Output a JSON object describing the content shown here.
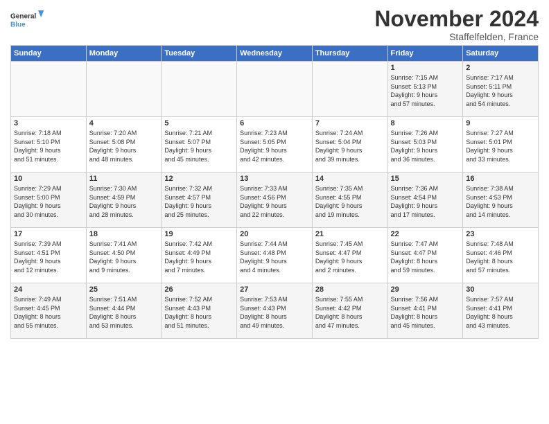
{
  "logo": {
    "line1": "General",
    "line2": "Blue"
  },
  "title": "November 2024",
  "location": "Staffelfelden, France",
  "days_of_week": [
    "Sunday",
    "Monday",
    "Tuesday",
    "Wednesday",
    "Thursday",
    "Friday",
    "Saturday"
  ],
  "weeks": [
    [
      {
        "day": "",
        "info": ""
      },
      {
        "day": "",
        "info": ""
      },
      {
        "day": "",
        "info": ""
      },
      {
        "day": "",
        "info": ""
      },
      {
        "day": "",
        "info": ""
      },
      {
        "day": "1",
        "info": "Sunrise: 7:15 AM\nSunset: 5:13 PM\nDaylight: 9 hours\nand 57 minutes."
      },
      {
        "day": "2",
        "info": "Sunrise: 7:17 AM\nSunset: 5:11 PM\nDaylight: 9 hours\nand 54 minutes."
      }
    ],
    [
      {
        "day": "3",
        "info": "Sunrise: 7:18 AM\nSunset: 5:10 PM\nDaylight: 9 hours\nand 51 minutes."
      },
      {
        "day": "4",
        "info": "Sunrise: 7:20 AM\nSunset: 5:08 PM\nDaylight: 9 hours\nand 48 minutes."
      },
      {
        "day": "5",
        "info": "Sunrise: 7:21 AM\nSunset: 5:07 PM\nDaylight: 9 hours\nand 45 minutes."
      },
      {
        "day": "6",
        "info": "Sunrise: 7:23 AM\nSunset: 5:05 PM\nDaylight: 9 hours\nand 42 minutes."
      },
      {
        "day": "7",
        "info": "Sunrise: 7:24 AM\nSunset: 5:04 PM\nDaylight: 9 hours\nand 39 minutes."
      },
      {
        "day": "8",
        "info": "Sunrise: 7:26 AM\nSunset: 5:03 PM\nDaylight: 9 hours\nand 36 minutes."
      },
      {
        "day": "9",
        "info": "Sunrise: 7:27 AM\nSunset: 5:01 PM\nDaylight: 9 hours\nand 33 minutes."
      }
    ],
    [
      {
        "day": "10",
        "info": "Sunrise: 7:29 AM\nSunset: 5:00 PM\nDaylight: 9 hours\nand 30 minutes."
      },
      {
        "day": "11",
        "info": "Sunrise: 7:30 AM\nSunset: 4:59 PM\nDaylight: 9 hours\nand 28 minutes."
      },
      {
        "day": "12",
        "info": "Sunrise: 7:32 AM\nSunset: 4:57 PM\nDaylight: 9 hours\nand 25 minutes."
      },
      {
        "day": "13",
        "info": "Sunrise: 7:33 AM\nSunset: 4:56 PM\nDaylight: 9 hours\nand 22 minutes."
      },
      {
        "day": "14",
        "info": "Sunrise: 7:35 AM\nSunset: 4:55 PM\nDaylight: 9 hours\nand 19 minutes."
      },
      {
        "day": "15",
        "info": "Sunrise: 7:36 AM\nSunset: 4:54 PM\nDaylight: 9 hours\nand 17 minutes."
      },
      {
        "day": "16",
        "info": "Sunrise: 7:38 AM\nSunset: 4:53 PM\nDaylight: 9 hours\nand 14 minutes."
      }
    ],
    [
      {
        "day": "17",
        "info": "Sunrise: 7:39 AM\nSunset: 4:51 PM\nDaylight: 9 hours\nand 12 minutes."
      },
      {
        "day": "18",
        "info": "Sunrise: 7:41 AM\nSunset: 4:50 PM\nDaylight: 9 hours\nand 9 minutes."
      },
      {
        "day": "19",
        "info": "Sunrise: 7:42 AM\nSunset: 4:49 PM\nDaylight: 9 hours\nand 7 minutes."
      },
      {
        "day": "20",
        "info": "Sunrise: 7:44 AM\nSunset: 4:48 PM\nDaylight: 9 hours\nand 4 minutes."
      },
      {
        "day": "21",
        "info": "Sunrise: 7:45 AM\nSunset: 4:47 PM\nDaylight: 9 hours\nand 2 minutes."
      },
      {
        "day": "22",
        "info": "Sunrise: 7:47 AM\nSunset: 4:47 PM\nDaylight: 8 hours\nand 59 minutes."
      },
      {
        "day": "23",
        "info": "Sunrise: 7:48 AM\nSunset: 4:46 PM\nDaylight: 8 hours\nand 57 minutes."
      }
    ],
    [
      {
        "day": "24",
        "info": "Sunrise: 7:49 AM\nSunset: 4:45 PM\nDaylight: 8 hours\nand 55 minutes."
      },
      {
        "day": "25",
        "info": "Sunrise: 7:51 AM\nSunset: 4:44 PM\nDaylight: 8 hours\nand 53 minutes."
      },
      {
        "day": "26",
        "info": "Sunrise: 7:52 AM\nSunset: 4:43 PM\nDaylight: 8 hours\nand 51 minutes."
      },
      {
        "day": "27",
        "info": "Sunrise: 7:53 AM\nSunset: 4:43 PM\nDaylight: 8 hours\nand 49 minutes."
      },
      {
        "day": "28",
        "info": "Sunrise: 7:55 AM\nSunset: 4:42 PM\nDaylight: 8 hours\nand 47 minutes."
      },
      {
        "day": "29",
        "info": "Sunrise: 7:56 AM\nSunset: 4:41 PM\nDaylight: 8 hours\nand 45 minutes."
      },
      {
        "day": "30",
        "info": "Sunrise: 7:57 AM\nSunset: 4:41 PM\nDaylight: 8 hours\nand 43 minutes."
      }
    ]
  ]
}
